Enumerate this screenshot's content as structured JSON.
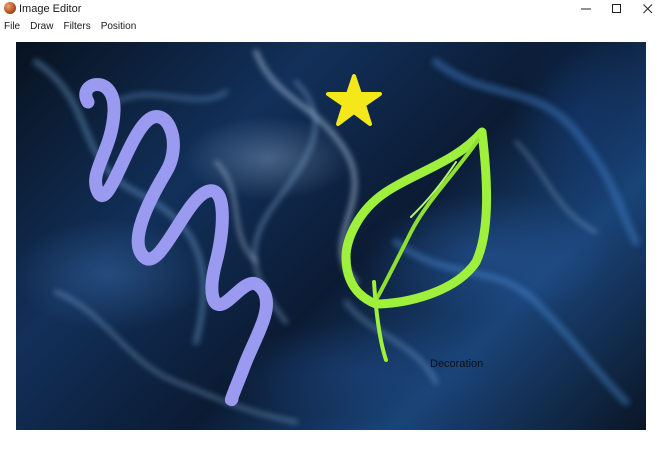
{
  "window": {
    "title": "Image Editor",
    "icon": "app-icon"
  },
  "menu": {
    "items": [
      "File",
      "Draw",
      "Filters",
      "Position"
    ]
  },
  "canvas": {
    "text_label": "Decoration",
    "strokes": [
      {
        "name": "zigzag-stroke",
        "color": "#9a9af0"
      },
      {
        "name": "star-shape",
        "color": "#f4e81a"
      },
      {
        "name": "leaf-stroke",
        "color": "#9ef03c"
      }
    ]
  }
}
